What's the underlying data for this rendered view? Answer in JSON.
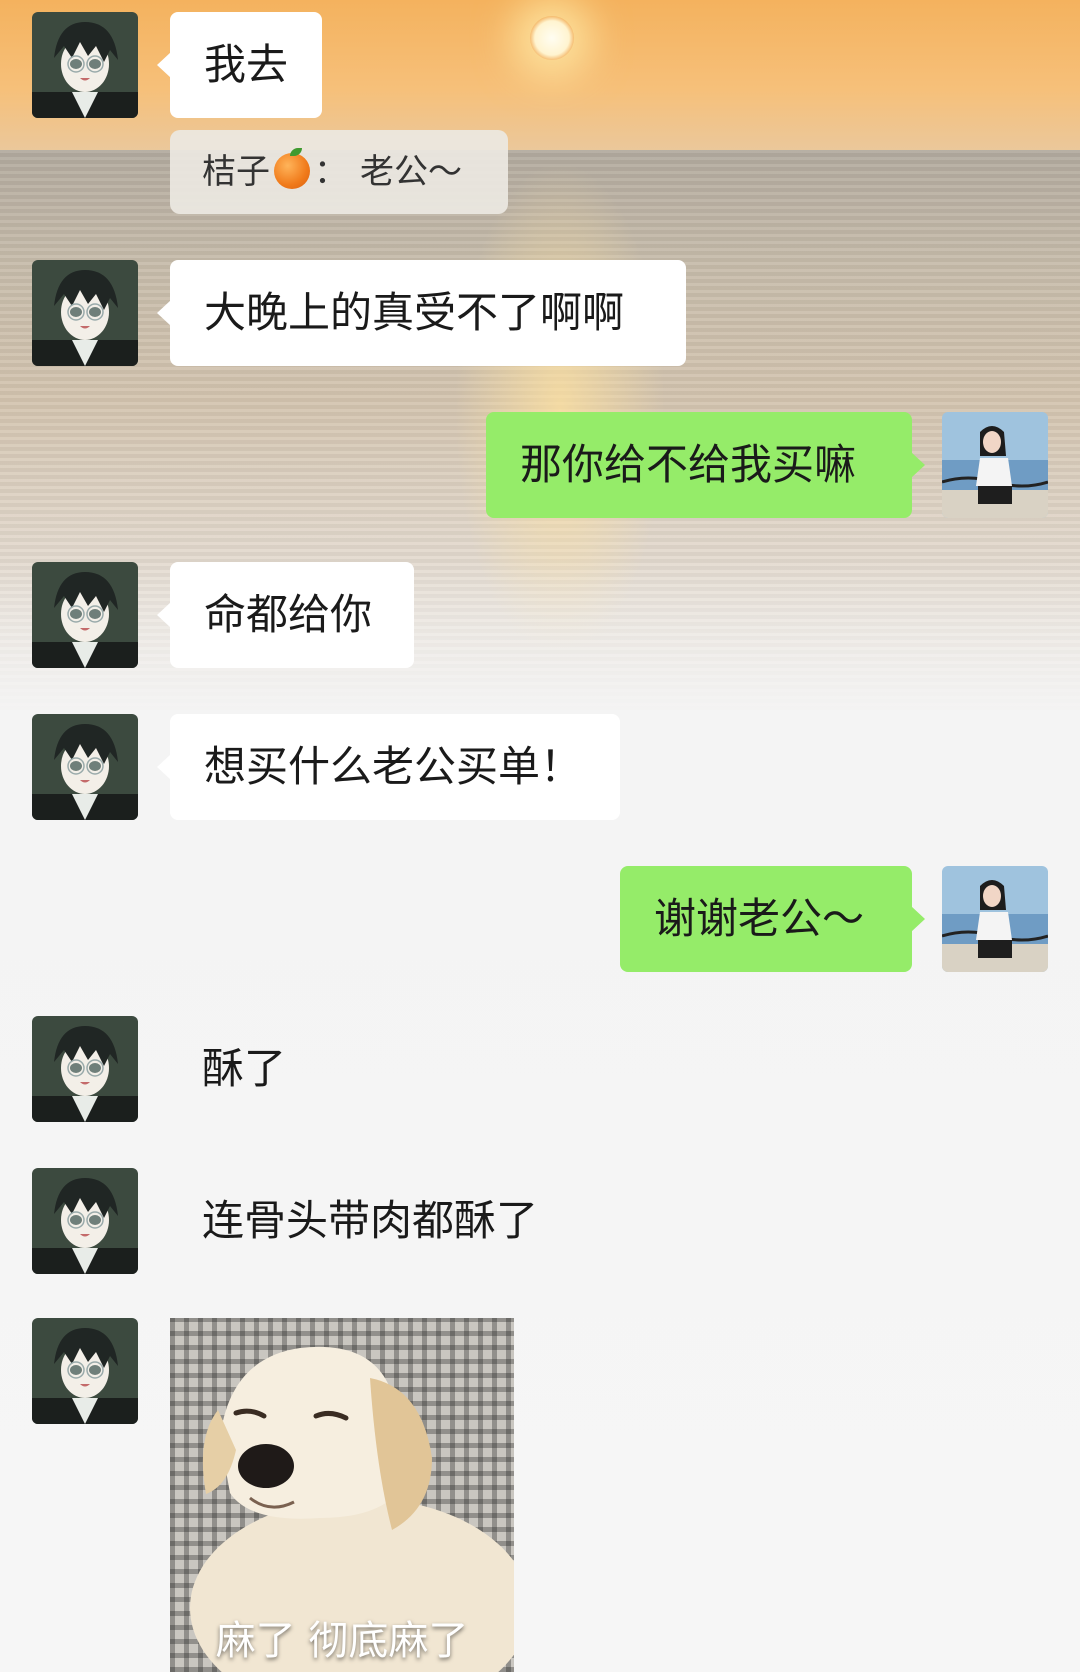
{
  "chat": {
    "messages": [
      {
        "sender": "other",
        "text": "我去"
      },
      {
        "quote": {
          "name": "桔子",
          "emoji": "orange",
          "separator": "：",
          "text": "老公～"
        }
      },
      {
        "sender": "other",
        "text": "大晚上的真受不了啊啊"
      },
      {
        "sender": "me",
        "text": "那你给不给我买嘛"
      },
      {
        "sender": "other",
        "text": "命都给你"
      },
      {
        "sender": "other",
        "text": "想买什么老公买单！"
      },
      {
        "sender": "me",
        "text": "谢谢老公～"
      },
      {
        "sender": "other",
        "text": "酥了"
      },
      {
        "sender": "other",
        "text": "连骨头带肉都酥了"
      },
      {
        "sender": "other",
        "sticker": {
          "subject": "sleepy golden retriever puppy",
          "caption": "麻了 彻底麻了"
        }
      }
    ]
  },
  "avatars": {
    "other": "anime-boy-avatar",
    "me": "girl-seaside-avatar"
  },
  "colors": {
    "incoming_bubble": "#ffffff",
    "outgoing_bubble": "#95ec69",
    "text": "#1a1a1a"
  }
}
